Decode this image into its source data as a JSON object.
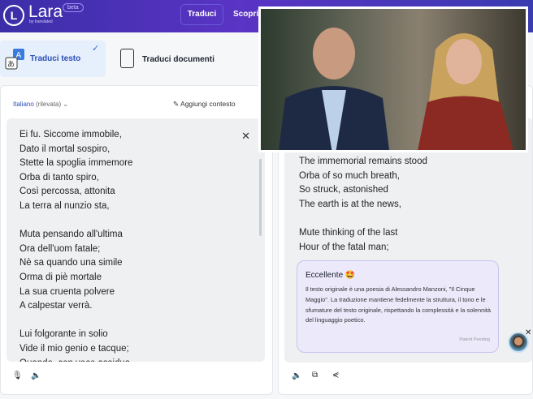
{
  "header": {
    "logo": "Lara",
    "logo_sub": "by translated",
    "badge": "beta",
    "nav": [
      "Traduci",
      "Scopri"
    ]
  },
  "tabs": [
    {
      "label": "Traduci testo",
      "active": true
    },
    {
      "label": "Traduci documenti",
      "active": false
    }
  ],
  "source": {
    "language": "Italiano",
    "detected": "(rilevata)",
    "context_button": "Aggiungi contesto",
    "text": "Ei fu. Siccome immobile,\nDato il mortal sospiro,\nStette la spoglia immemore\nOrba di tanto spiro,\nCosì percossa, attonita\nLa terra al nunzio sta,\n\nMuta pensando all'ultima\nOra dell'uom fatale;\nNè sa quando una simile\nOrma di piè mortale\nLa sua cruenta polvere\nA calpestar verrà.\n\nLui folgorante in solio\nVide il mio genio e tacque;\nQuando, con voce assidua"
  },
  "target": {
    "text": "The immemorial remains stood\nOrba of so much breath,\nSo struck, astonished\nThe earth is at the news,\n\nMute thinking of the last\nHour of the fatal man;"
  },
  "feedback": {
    "title": "Eccellente 🤩",
    "body": "Il testo originale è una poesia di Alessandro Manzoni, \"Il Cinque Maggio\". La traduzione mantiene fedelmente la struttura, il tono e le sfumature del testo originale, rispettando la complessità e la solennità del linguaggio poetico.",
    "footer": "Patent Pending"
  }
}
